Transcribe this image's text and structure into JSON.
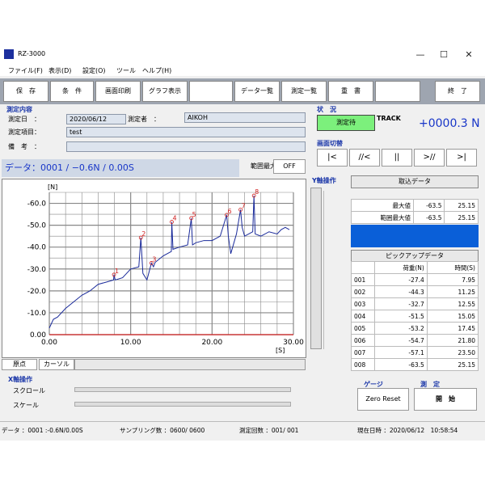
{
  "window": {
    "title": "RZ-3000",
    "min": "—",
    "max": "☐",
    "close": "✕"
  },
  "menu": [
    "ファイル(F)",
    "表示(D)",
    "設定(O)",
    "ツール",
    "ヘルプ(H)"
  ],
  "toolbar": [
    "保　存",
    "条　件",
    "画面印刷",
    "グラフ表示",
    "",
    "データ一覧",
    "測定一覧",
    "重　書",
    "",
    "終　了"
  ],
  "measure": {
    "section_title": "測定内容",
    "date_label": "測定日　：",
    "date_value": "2020/06/12",
    "operator_label": "測定者　：",
    "operator_value": "AIKOH",
    "item_label": "測定項目：",
    "item_value": "test",
    "note_label": "備　考　：",
    "note_value": ""
  },
  "status": {
    "title": "状　況",
    "state": "測定待",
    "mode": "TRACK",
    "force": "+0000.3 N"
  },
  "screen_switch": {
    "title": "画面切替",
    "buttons": [
      "|<",
      "//<",
      "||",
      ">//",
      ">|"
    ]
  },
  "data_line": "データ：0001 / −0.6N / 0.00S",
  "range_max": {
    "label": "範囲最大値",
    "button": "OFF"
  },
  "y_axis_op": "Y軸操作",
  "x_axis_op": {
    "title": "X軸操作",
    "scroll": "スクロール",
    "scale": "スケール"
  },
  "chart_controls": {
    "origin": "原点",
    "cursor": "カーソル"
  },
  "capture": {
    "title": "取込データ",
    "rows": [
      {
        "label": "最大値",
        "value": "-63.5",
        "time": "25.15"
      },
      {
        "label": "範囲最大値",
        "value": "-63.5",
        "time": "25.15"
      }
    ]
  },
  "pickup": {
    "title": "ピックアップデータ",
    "headers": [
      "",
      "荷重(N)",
      "時間(S)"
    ],
    "rows": [
      [
        "001",
        "-27.4",
        "7.95"
      ],
      [
        "002",
        "-44.3",
        "11.25"
      ],
      [
        "003",
        "-32.7",
        "12.55"
      ],
      [
        "004",
        "-51.5",
        "15.05"
      ],
      [
        "005",
        "-53.2",
        "17.45"
      ],
      [
        "006",
        "-54.7",
        "21.80"
      ],
      [
        "007",
        "-57.1",
        "23.50"
      ],
      [
        "008",
        "-63.5",
        "25.15"
      ]
    ]
  },
  "gauge": {
    "title": "ゲージ",
    "button": "Zero Reset"
  },
  "measure_start": {
    "title": "測　定",
    "button": "開　始"
  },
  "statusbar": {
    "data": "データ ：0001 :-0.6N/0.00S",
    "sampling": "サンプリング数 ：0600/ 0600",
    "count": "測定回数 ：001/ 001",
    "now": "現在日時 ：2020/06/12　10:58:54"
  },
  "chart_data": {
    "type": "line",
    "ylabel": "[N]",
    "xlabel": "[S]",
    "xlim": [
      0,
      30
    ],
    "ylim": [
      0,
      -65
    ],
    "x_ticks": [
      "0.00",
      "10.00",
      "20.00",
      "30.00"
    ],
    "y_ticks": [
      "0.00",
      "-10.0",
      "-20.0",
      "-30.0",
      "-40.0",
      "-50.0",
      "-60.0"
    ],
    "series": [
      {
        "color": "#1a2a9a",
        "x": [
          0,
          0.5,
          1,
          2,
          3,
          4,
          5,
          6,
          7,
          7.9,
          7.95,
          8.1,
          9,
          10,
          11,
          11.25,
          11.5,
          12,
          12.55,
          12.8,
          13,
          14,
          15,
          15.05,
          15.2,
          16,
          17,
          17.45,
          17.6,
          18,
          19,
          20,
          21,
          21.8,
          22,
          22.3,
          23,
          23.5,
          23.7,
          24,
          25,
          25.15,
          25.3,
          26,
          27,
          28,
          28.5,
          29,
          29.5
        ],
        "y": [
          -3,
          -7,
          -8,
          -12,
          -15,
          -18,
          -20,
          -23,
          -24,
          -25,
          -27.4,
          -25,
          -26,
          -30,
          -31,
          -44.3,
          -28,
          -25,
          -32.7,
          -31,
          -33,
          -36,
          -38,
          -51.5,
          -39,
          -40,
          -41,
          -53.2,
          -41,
          -42,
          -43,
          -43,
          -45,
          -54.7,
          -45,
          -37,
          -46,
          -57.1,
          -49,
          -45,
          -47,
          -63.5,
          -46,
          -45,
          -47,
          -46,
          -48,
          -49,
          -48
        ]
      }
    ],
    "markers": [
      "1",
      "2",
      "3",
      "4",
      "5",
      "6",
      "7",
      "8"
    ]
  }
}
